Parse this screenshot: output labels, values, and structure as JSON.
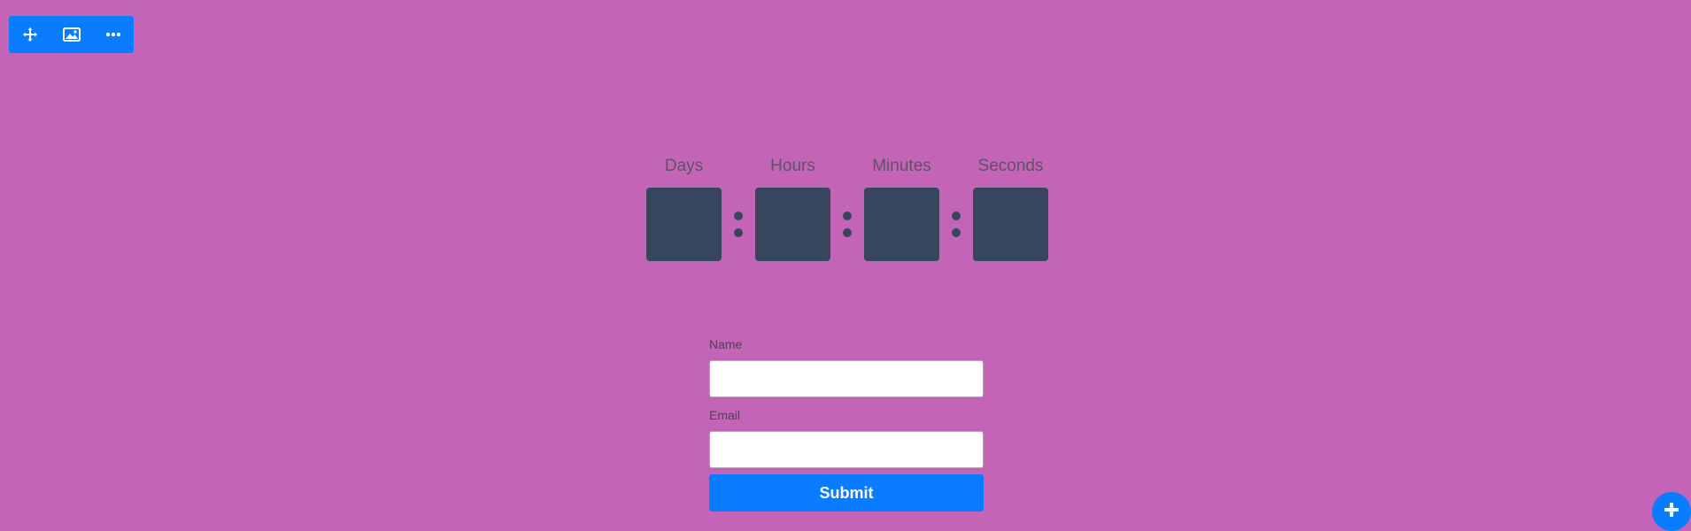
{
  "toolbar": {
    "buttons": [
      {
        "icon": "move-icon"
      },
      {
        "icon": "image-icon"
      },
      {
        "icon": "more-icon"
      }
    ],
    "color": "#0a7cff"
  },
  "countdown": {
    "units": [
      {
        "label": "Days",
        "value": ""
      },
      {
        "label": "Hours",
        "value": ""
      },
      {
        "label": "Minutes",
        "value": ""
      },
      {
        "label": "Seconds",
        "value": ""
      }
    ],
    "box_color": "#37465d",
    "label_color": "#5d5468"
  },
  "form": {
    "name_label": "Name",
    "name_value": "",
    "email_label": "Email",
    "email_value": "",
    "submit_label": "Submit"
  },
  "add_button": {
    "icon": "plus-icon"
  },
  "colors": {
    "background": "#c364b6",
    "accent": "#0a7cff"
  }
}
